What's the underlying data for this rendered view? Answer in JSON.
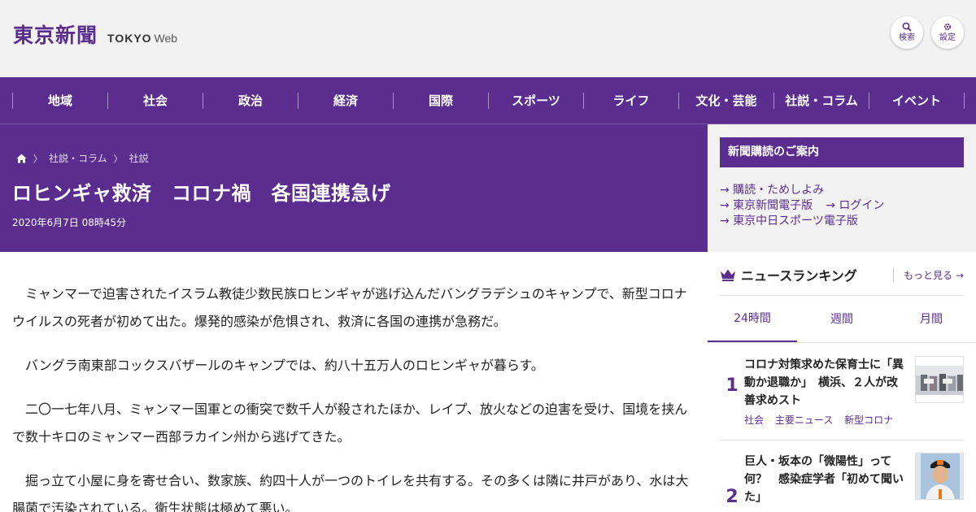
{
  "header": {
    "logo_jp": "東京新聞",
    "logo_en": "TOKYO",
    "logo_web": "Web",
    "search_label": "検索",
    "settings_label": "設定"
  },
  "nav": {
    "items": [
      "地域",
      "社会",
      "政治",
      "経済",
      "国際",
      "スポーツ",
      "ライフ",
      "文化・芸能",
      "社説・コラム",
      "イベント"
    ]
  },
  "article": {
    "breadcrumb": [
      "社説・コラム",
      "社説"
    ],
    "title": "ロヒンギャ救済　コロナ禍　各国連携急げ",
    "date": "2020年6月7日 08時45分",
    "paragraphs": [
      "ミャンマーで迫害されたイスラム教徒少数民族ロヒンギャが逃げ込んだバングラデシュのキャンプで、新型コロナウイルスの死者が初めて出た。爆発的感染が危惧され、救済に各国の連携が急務だ。",
      "バングラ南東部コックスバザールのキャンプでは、約八十五万人のロヒンギャが暮らす。",
      "二〇一七年八月、ミャンマー国軍との衝突で数千人が殺されたほか、レイプ、放火などの迫害を受け、国境を挟んで数十キロのミャンマー西部ラカイン州から逃げてきた。",
      "掘っ立て小屋に身を寄せ合い、数家族、約四十人が一つのトイレを共有する。その多くは隣に井戸があり、水は大腸菌で汚染されている。衛生状態は極めて悪い。"
    ]
  },
  "subscription": {
    "heading": "新聞購読のご案内",
    "links": [
      "→ 購読・ためしよみ",
      "→ 東京新聞電子版",
      "→ ログイン",
      "→ 東京中日スポーツ電子版"
    ]
  },
  "ranking": {
    "title": "ニュースランキング",
    "more_label": "もっと見る →",
    "tabs": [
      "24時間",
      "週間",
      "月間"
    ],
    "active_tab": "24時間",
    "items": [
      {
        "rank": "1",
        "title": "コロナ対策求めた保育士に「異動か退職か」　横浜、２人が改善求めスト",
        "tags": [
          "社会",
          "主要ニュース",
          "新型コロナ"
        ]
      },
      {
        "rank": "2",
        "title": "巨人・坂本の「微陽性」って何？　感染症学者「初めて聞いた」",
        "tags": []
      }
    ]
  },
  "colors": {
    "brand_purple": "#5b2d8e",
    "background": "#f2f2f2"
  }
}
